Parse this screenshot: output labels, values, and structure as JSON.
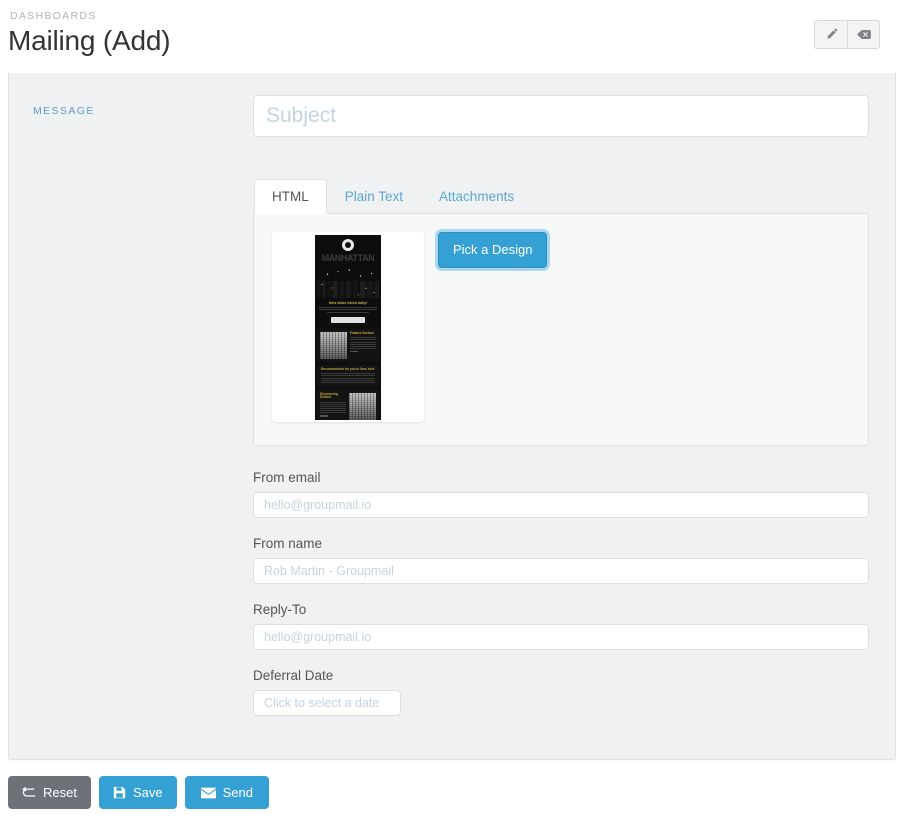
{
  "header": {
    "breadcrumb": "DASHBOARDS",
    "title": "Mailing (Add)",
    "actions": [
      {
        "name": "edit-button",
        "icon": "pencil-icon"
      },
      {
        "name": "clear-button",
        "icon": "backspace-icon"
      }
    ]
  },
  "panel": {
    "legend": "MESSAGE",
    "subject": {
      "value": "",
      "placeholder": "Subject"
    },
    "tabs": [
      {
        "label": "HTML",
        "active": true
      },
      {
        "label": "Plain Text",
        "active": false
      },
      {
        "label": "Attachments",
        "active": false
      }
    ],
    "design": {
      "pick_label": "Pick a Design",
      "template": {
        "logo": "circle-logo",
        "wordmark": "MANHATTAN",
        "headline": "New deals listed daily!",
        "cta": "button",
        "section_1_title": "Feature Section",
        "section_2_title": "Recommended for you in New York",
        "section_3_title": "Discovering District",
        "social_icons": [
          "facebook-icon",
          "twitter-icon",
          "pinterest-icon"
        ]
      }
    },
    "fields": [
      {
        "name": "from-email",
        "label": "From email",
        "value": "",
        "placeholder": "hello@groupmail.io",
        "narrow": false
      },
      {
        "name": "from-name",
        "label": "From name",
        "value": "",
        "placeholder": "Rob Martin - Groupmail",
        "narrow": false
      },
      {
        "name": "reply-to",
        "label": "Reply-To",
        "value": "",
        "placeholder": "hello@groupmail.io",
        "narrow": false
      },
      {
        "name": "deferral-date",
        "label": "Deferral Date",
        "value": "",
        "placeholder": "Click to select a date",
        "narrow": true
      }
    ]
  },
  "footer": {
    "reset_label": "Reset",
    "save_label": "Save",
    "send_label": "Send"
  },
  "colors": {
    "accent": "#35a0d3",
    "legend": "#5b9bc4",
    "muted": "#6d7278",
    "placeholder": "#c3d4de"
  }
}
